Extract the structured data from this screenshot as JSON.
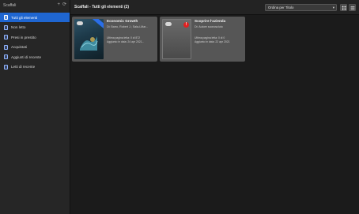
{
  "sidebar": {
    "title": "Scaffali",
    "icons": [
      "plus-icon",
      "sync-icon"
    ],
    "items": [
      {
        "label": "Tutti gli elementi",
        "active": true
      },
      {
        "label": "Non letto",
        "active": false
      },
      {
        "label": "Presi in prestito",
        "active": false
      },
      {
        "label": "Acquistati",
        "active": false
      },
      {
        "label": "Aggiunti di recente",
        "active": false
      },
      {
        "label": "Letti di recente",
        "active": false
      }
    ]
  },
  "main": {
    "title": "Scaffali - Tutti gli elementi (2)",
    "sort": {
      "selected": "Ordina per Titolo"
    },
    "view_buttons": [
      "grid-view-icon",
      "list-view-icon"
    ]
  },
  "books": [
    {
      "title": "Economic Growth",
      "author": "Di: Barro, Robert J.; Sala-i-Mar...",
      "last_page": "Ultima pagina letta: 0 di 872",
      "added": "Aggiunto in data: 24 apr 2021...",
      "badge": "cloud-icon",
      "status_color": "#2a6ee8"
    },
    {
      "title": "Scoprire l'azienda",
      "author": "Di: Autore sconosciuto",
      "last_page": "Ultima pagina letta: 0 di 0",
      "added": "Aggiunto in data: 22 apr 2021",
      "badge": "cloud-icon",
      "alert": "!",
      "status_color": "#e02020"
    }
  ],
  "colors": {
    "accent": "#1f66d1",
    "card_bg": "#565656",
    "alert": "#e02020"
  }
}
